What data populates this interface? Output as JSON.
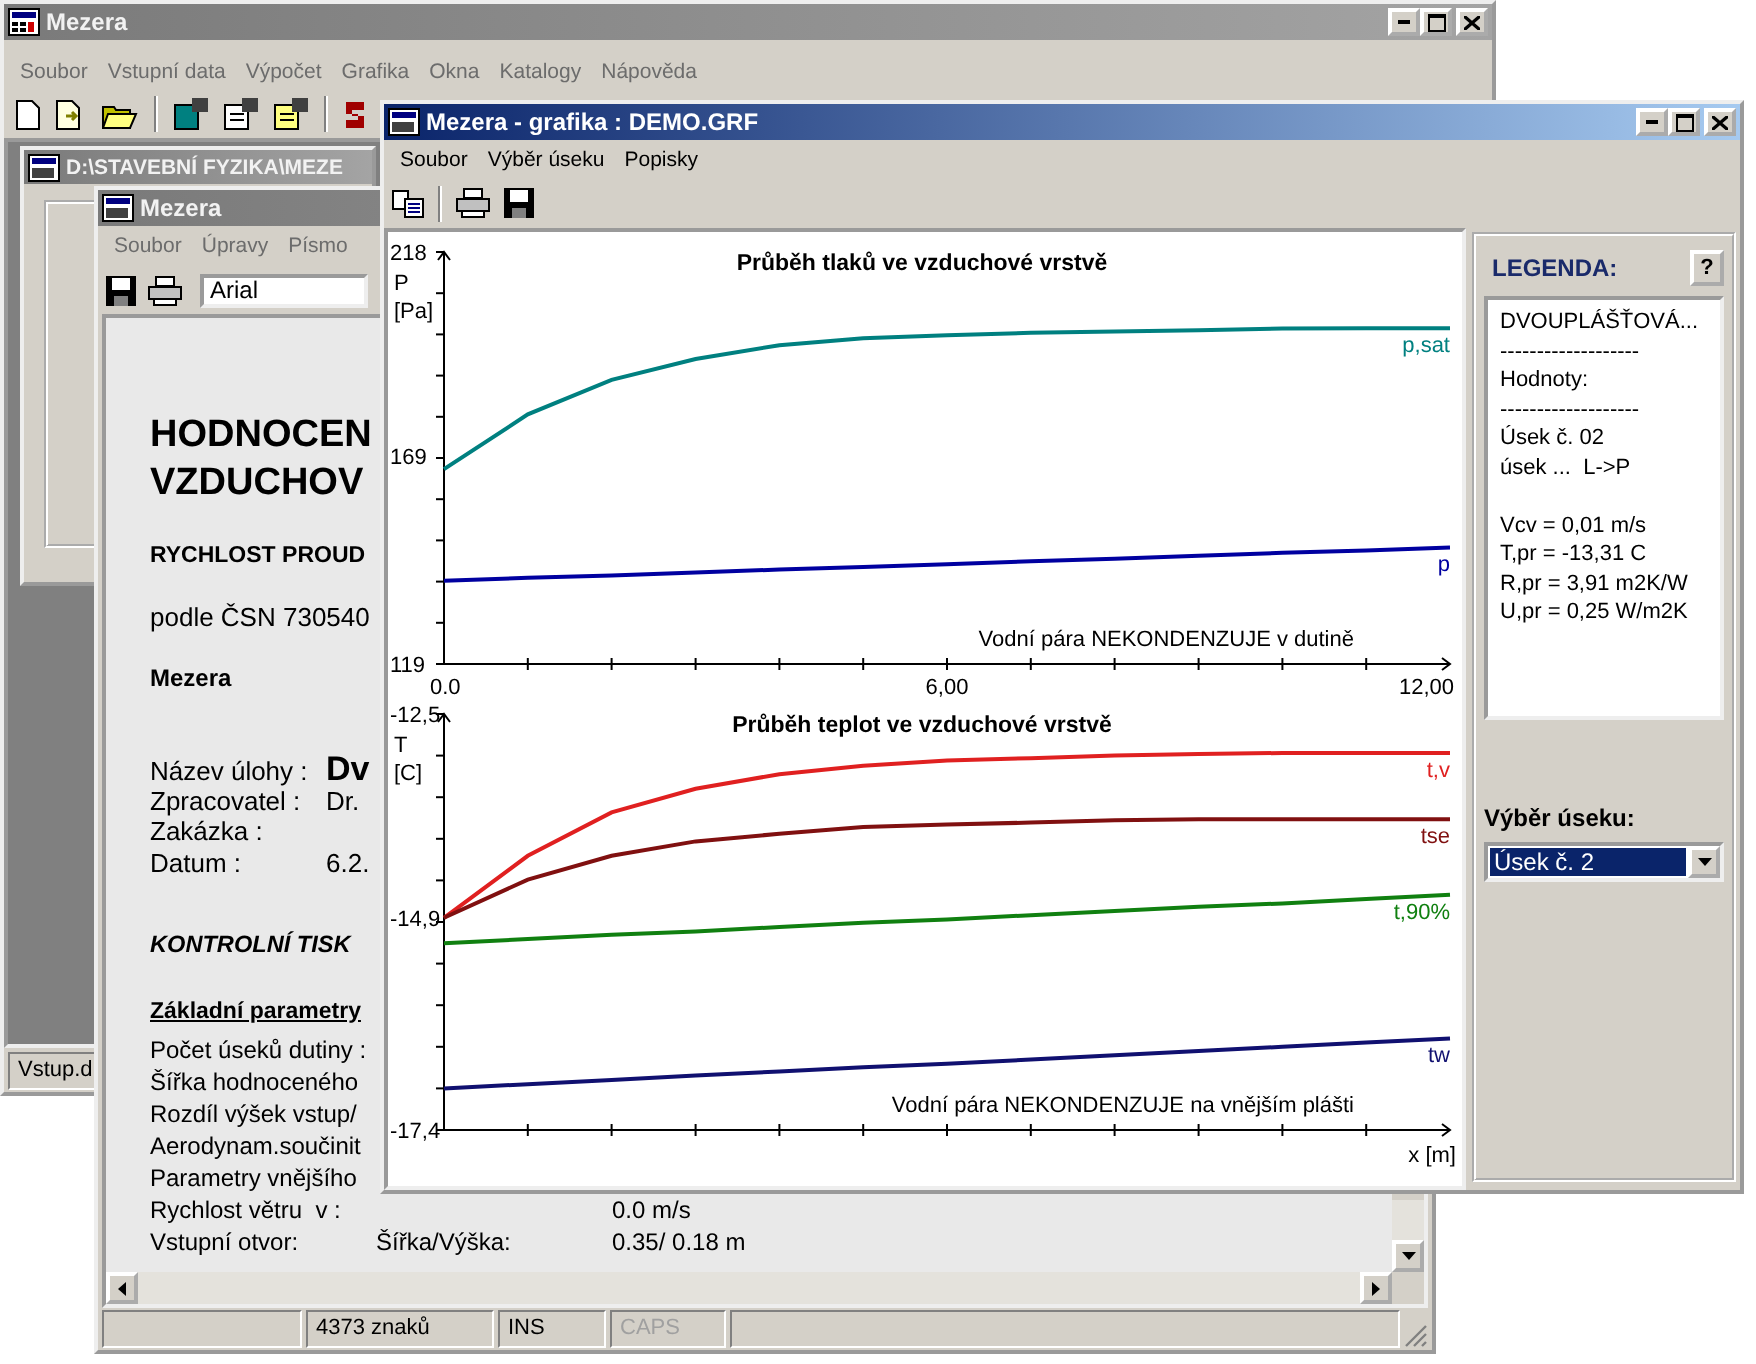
{
  "main_window": {
    "title": "Mezera",
    "menu": [
      "Soubor",
      "Vstupní data",
      "Výpočet",
      "Grafika",
      "Okna",
      "Katalogy",
      "Nápověda"
    ],
    "child_window": {
      "title": "D:\\STAVEBNÍ FYZIKA\\MEZE"
    },
    "status_bar": "Vstup.d"
  },
  "editor_window": {
    "title": "Mezera",
    "menu": [
      "Soubor",
      "Úpravy",
      "Písmo"
    ],
    "font_box": {
      "value": "Arial"
    },
    "document": {
      "heading": [
        "HODNOCEN",
        "VZDUCHOV"
      ],
      "subheading": "RYCHLOST PROUD",
      "standard": "podle ČSN 730540",
      "program": "Mezera",
      "task": {
        "label": "Název úlohy :",
        "value": "Dv"
      },
      "info": [
        {
          "label": "Zpracovatel :",
          "value": "Dr."
        },
        {
          "label": "Zakázka :"
        },
        {
          "label": "Datum :",
          "value": "6.2."
        }
      ],
      "section": "KONTROLNÍ TISK",
      "params_heading": "Základní parametry",
      "params": [
        {
          "label": "Počet úseků dutiny :"
        },
        {
          "label": "Šířka hodnoceného"
        },
        {
          "label": "Rozdíl výšek vstup/"
        },
        {
          "label": "Aerodynam.součinit"
        },
        {
          "label": "Parametry vnějšího"
        },
        {
          "label": "Rychlost větru  v :",
          "value": "0.0 m/s"
        },
        {
          "label": "Vstupní otvor:",
          "sub": "Šířka/Výška:",
          "value": "0.35/ 0.18 m"
        }
      ]
    },
    "status_bar": [
      {
        "text": "4373 znaků",
        "disabled": false
      },
      {
        "text": "INS",
        "disabled": false
      },
      {
        "text": "CAPS",
        "disabled": true
      }
    ]
  },
  "graphics_window": {
    "title": "Mezera - grafika : DEMO.GRF",
    "menu": [
      "Soubor",
      "Výběr úseku",
      "Popisky"
    ],
    "charts": [
      {
        "chart_data": {
          "type": "line",
          "title": "Průběh tlaků ve vzduchové vrstvě",
          "ylabel": "P [Pa]",
          "x": [
            0,
            1,
            2,
            3,
            4,
            5,
            6,
            7,
            8,
            9,
            10,
            11,
            12
          ],
          "series": [
            {
              "name": "p,sat",
              "color": "#008080",
              "values": [
                165.8,
                179,
                187.3,
                192.3,
                195.6,
                197.3,
                198,
                198.6,
                198.9,
                199.2,
                199.6,
                199.7,
                199.7
              ]
            },
            {
              "name": "p",
              "color": "#0000a0",
              "values": [
                139,
                139.7,
                140.3,
                141,
                141.7,
                142.3,
                143,
                143.7,
                144.3,
                145,
                145.7,
                146.3,
                147
              ]
            }
          ],
          "xlim": [
            0,
            12
          ],
          "ylim": [
            119,
            218
          ],
          "xticks": [
            {
              "value": 0,
              "label": "0.0"
            },
            {
              "value": 6,
              "label": "6,00"
            },
            {
              "value": 12,
              "label": "12,00"
            }
          ],
          "yticks": [
            119,
            169,
            218
          ],
          "annotations": [
            {
              "text": "Vodní pára NEKONDENZUJE v dutině"
            }
          ]
        }
      },
      {
        "chart_data": {
          "type": "line",
          "title": "Průběh teplot ve vzduchové vrstvě",
          "ylabel": "T [C]",
          "xlabel": "x [m]",
          "x": [
            0,
            1,
            2,
            3,
            4,
            5,
            6,
            7,
            8,
            9,
            10,
            11,
            12
          ],
          "series": [
            {
              "name": "t,v",
              "color": "#e02020",
              "values": [
                -14.9,
                -14.17,
                -13.66,
                -13.38,
                -13.21,
                -13.11,
                -13.05,
                -13.02,
                -12.99,
                -12.97,
                -12.96,
                -12.96,
                -12.96
              ]
            },
            {
              "name": "tse",
              "color": "#801010",
              "values": [
                -14.9,
                -14.45,
                -14.17,
                -14.0,
                -13.91,
                -13.83,
                -13.8,
                -13.78,
                -13.75,
                -13.74,
                -13.74,
                -13.74,
                -13.74
              ]
            },
            {
              "name": "t,90%",
              "color": "#108010",
              "values": [
                -15.2,
                -15.15,
                -15.1,
                -15.06,
                -15.01,
                -14.96,
                -14.92,
                -14.87,
                -14.82,
                -14.77,
                -14.73,
                -14.68,
                -14.63
              ]
            },
            {
              "name": "tw",
              "color": "#101070",
              "values": [
                -16.91,
                -16.86,
                -16.81,
                -16.76,
                -16.71,
                -16.66,
                -16.62,
                -16.57,
                -16.52,
                -16.47,
                -16.42,
                -16.37,
                -16.32
              ]
            }
          ],
          "xlim": [
            0,
            12
          ],
          "ylim": [
            -17.4,
            -12.5
          ],
          "yticks": [
            {
              "value": -17.4,
              "label": "-17,4"
            },
            {
              "value": -14.9,
              "label": "-14,9"
            },
            {
              "value": -12.5,
              "label": "-12,5"
            }
          ],
          "annotations": [
            {
              "text": "Vodní pára NEKONDENZUJE na vnějším plášti"
            }
          ]
        }
      }
    ],
    "legend": {
      "title": "LEGENDA:",
      "help": "?",
      "blocks": [
        [
          "DVOUPLÁŠŤOVÁ...",
          "-------------------",
          "Hodnoty:",
          "-------------------",
          "Úsek č. 02",
          "úsek ...  L->P"
        ],
        [
          "Vcv = 0,01 m/s",
          "T,pr = -13,31 C",
          "R,pr = 3,91 m2K/W",
          "U,pr = 0,25 W/m2K"
        ]
      ]
    },
    "section_select": {
      "label": "Výběr úseku:",
      "value": "Úsek č. 2"
    }
  }
}
